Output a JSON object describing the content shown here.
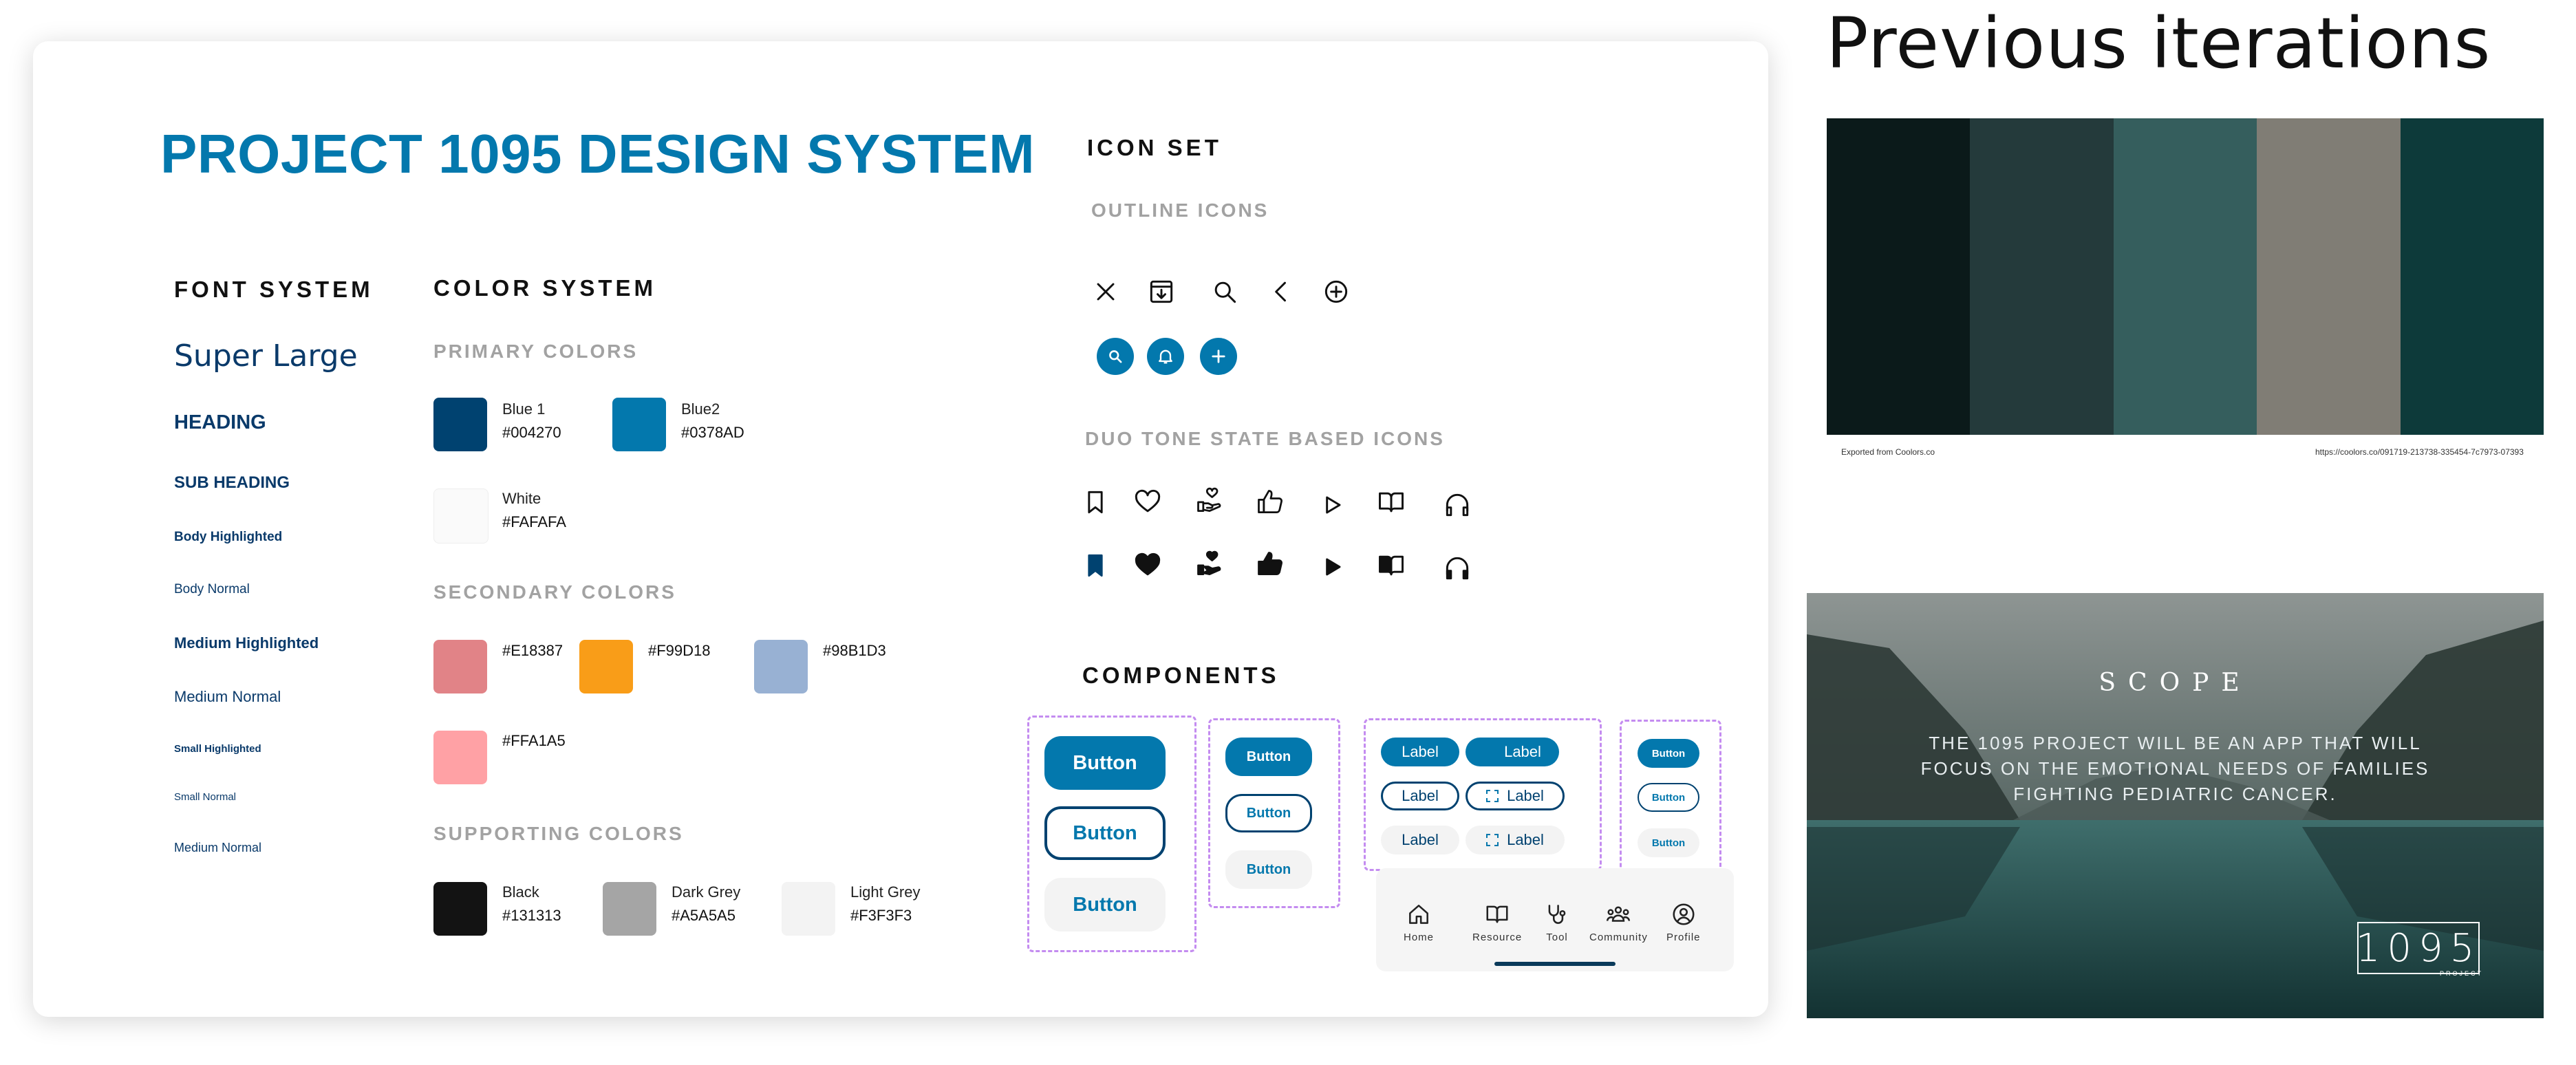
{
  "design_system": {
    "title": "PROJECT 1095 DESIGN SYSTEM",
    "font_system": {
      "heading": "FONT SYSTEM",
      "samples": [
        "Super Large",
        "HEADING",
        "SUB HEADING",
        "Body Highlighted",
        "Body Normal",
        "Medium Highlighted",
        "Medium Normal",
        "Small Highlighted",
        "Small Normal",
        "Medium Normal"
      ]
    },
    "color_system": {
      "heading": "COLOR SYSTEM",
      "primary": {
        "heading": "PRIMARY COLORS",
        "swatches": [
          {
            "name": "Blue 1",
            "hex": "#004270"
          },
          {
            "name": "Blue2",
            "hex": "#0378AD"
          },
          {
            "name": "White",
            "hex": "#FAFAFA"
          }
        ]
      },
      "secondary": {
        "heading": "SECONDARY COLORS",
        "swatches": [
          {
            "hex": "#E18387"
          },
          {
            "hex": "#F99D18"
          },
          {
            "hex": "#98B1D3"
          },
          {
            "hex": "#FFA1A5"
          }
        ]
      },
      "supporting": {
        "heading": "SUPPORTING COLORS",
        "swatches": [
          {
            "name": "Black",
            "hex": "#131313"
          },
          {
            "name": "Dark Grey",
            "hex": "#A5A5A5"
          },
          {
            "name": "Light Grey",
            "hex": "#F3F3F3"
          }
        ]
      }
    },
    "icon_set": {
      "heading": "ICON SET",
      "outline_heading": "OUTLINE ICONS",
      "outline_icons": [
        "close-icon",
        "archive-download-icon",
        "search-icon",
        "chevron-left-icon",
        "plus-circle-icon"
      ],
      "filled_circle_icons": [
        "search-icon",
        "bell-icon",
        "plus-icon"
      ],
      "duotone_heading": "DUO TONE STATE BASED ICONS",
      "duotone_icons": [
        "bookmark-icon",
        "heart-icon",
        "hand-heart-icon",
        "thumbs-up-icon",
        "play-icon",
        "book-open-icon",
        "headphones-icon"
      ]
    },
    "components": {
      "heading": "COMPONENTS",
      "button_label": "Button",
      "chip_label": "Label",
      "nav": [
        "Home",
        "Resource",
        "Tool",
        "Community",
        "Profile"
      ]
    }
  },
  "previous": {
    "title": "Previous iterations",
    "palette": [
      "#0b1a1a",
      "#243a3b",
      "#355e5d",
      "#807d75",
      "#0d3a3a"
    ],
    "palette_footer_left": "Exported from Coolors.co",
    "palette_footer_right": "https://coolors.co/091719-213738-335454-7c7973-07393",
    "scope_heading": "SCOPE",
    "scope_text": "THE 1095 PROJECT WILL BE AN APP THAT WILL FOCUS ON THE EMOTIONAL NEEDS OF FAMILIES FIGHTING PEDIATRIC CANCER.",
    "logo_text": "1095",
    "logo_sub": "PROJECT"
  }
}
